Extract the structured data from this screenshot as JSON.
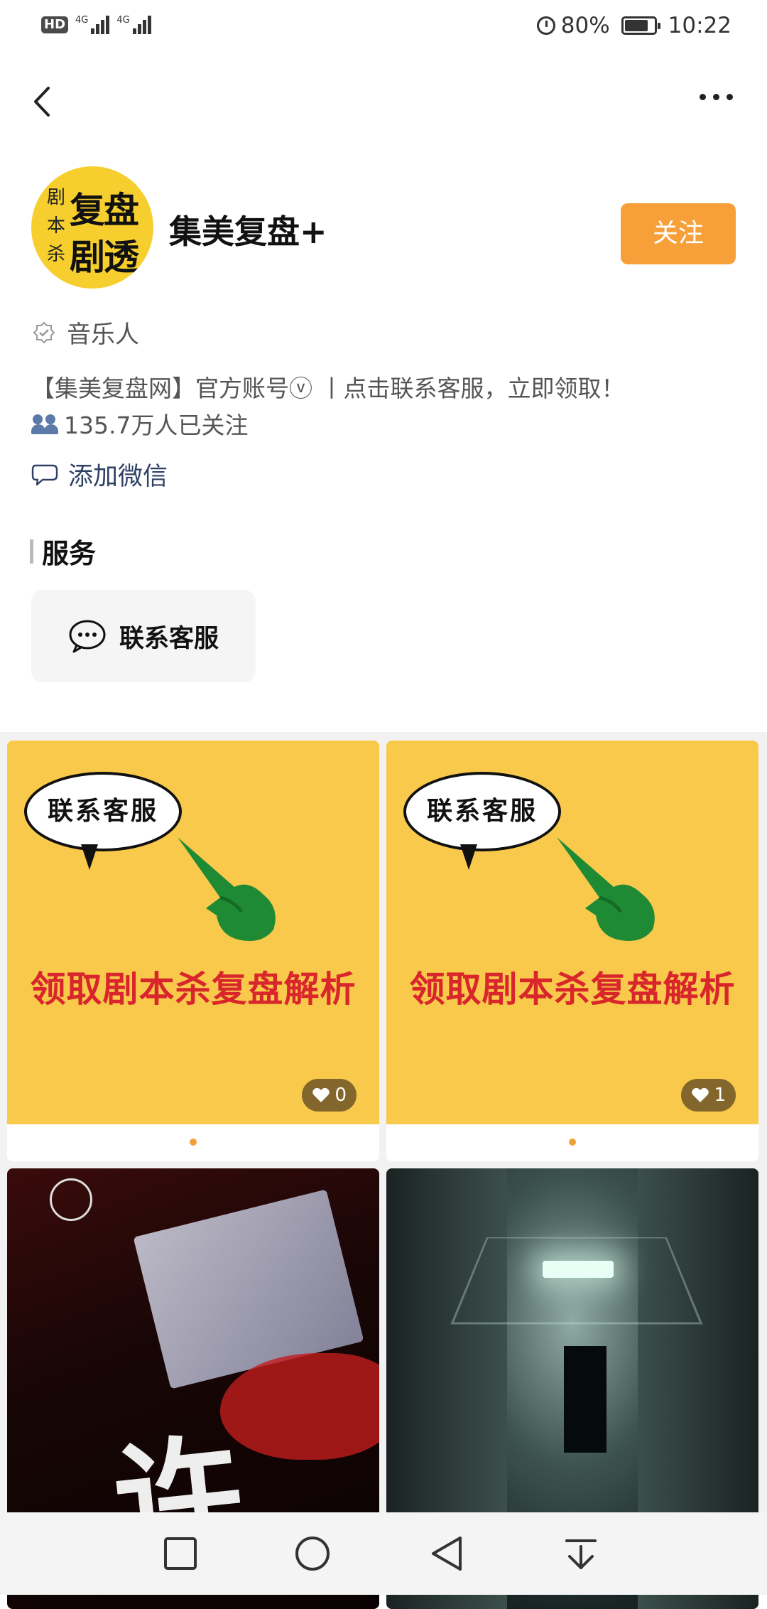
{
  "status_bar": {
    "hd": "HD",
    "network1": "4G",
    "network2": "4G",
    "battery_percent": "80%",
    "battery_level": 0.8,
    "time": "10:22"
  },
  "top_nav": {
    "back_icon": "chevron-left-icon",
    "more_icon": "more-horizontal-icon"
  },
  "profile": {
    "avatar_text_small": [
      "剧",
      "本",
      "杀"
    ],
    "avatar_text_big": [
      "复盘",
      "剧透"
    ],
    "name": "集美复盘+",
    "follow_label": "关注",
    "certification": "音乐人",
    "bio": "【集美复盘网】官方账号ⓥ 丨点击联系客服，立即领取！",
    "followers": "135.7万人已关注",
    "wechat_label": "添加微信"
  },
  "services": {
    "title": "服务",
    "items": [
      {
        "label": "联系客服",
        "icon": "chat-bubble-icon"
      }
    ]
  },
  "posts": [
    {
      "type": "promo",
      "bubble_text": "联系客服",
      "headline": "领取剧本杀复盘解析",
      "likes": "0"
    },
    {
      "type": "promo",
      "bubble_text": "联系客服",
      "headline": "领取剧本杀复盘解析",
      "likes": "1"
    },
    {
      "type": "poster",
      "title_char": "许"
    },
    {
      "type": "photo"
    }
  ],
  "bottom_nav": {
    "icons": [
      "square-icon",
      "circle-icon",
      "triangle-back-icon",
      "download-arrow-icon"
    ]
  },
  "colors": {
    "accent": "#f7a03a",
    "promo_bg": "#f8c94a",
    "promo_text": "#d8262c",
    "link": "#2f3f66"
  }
}
